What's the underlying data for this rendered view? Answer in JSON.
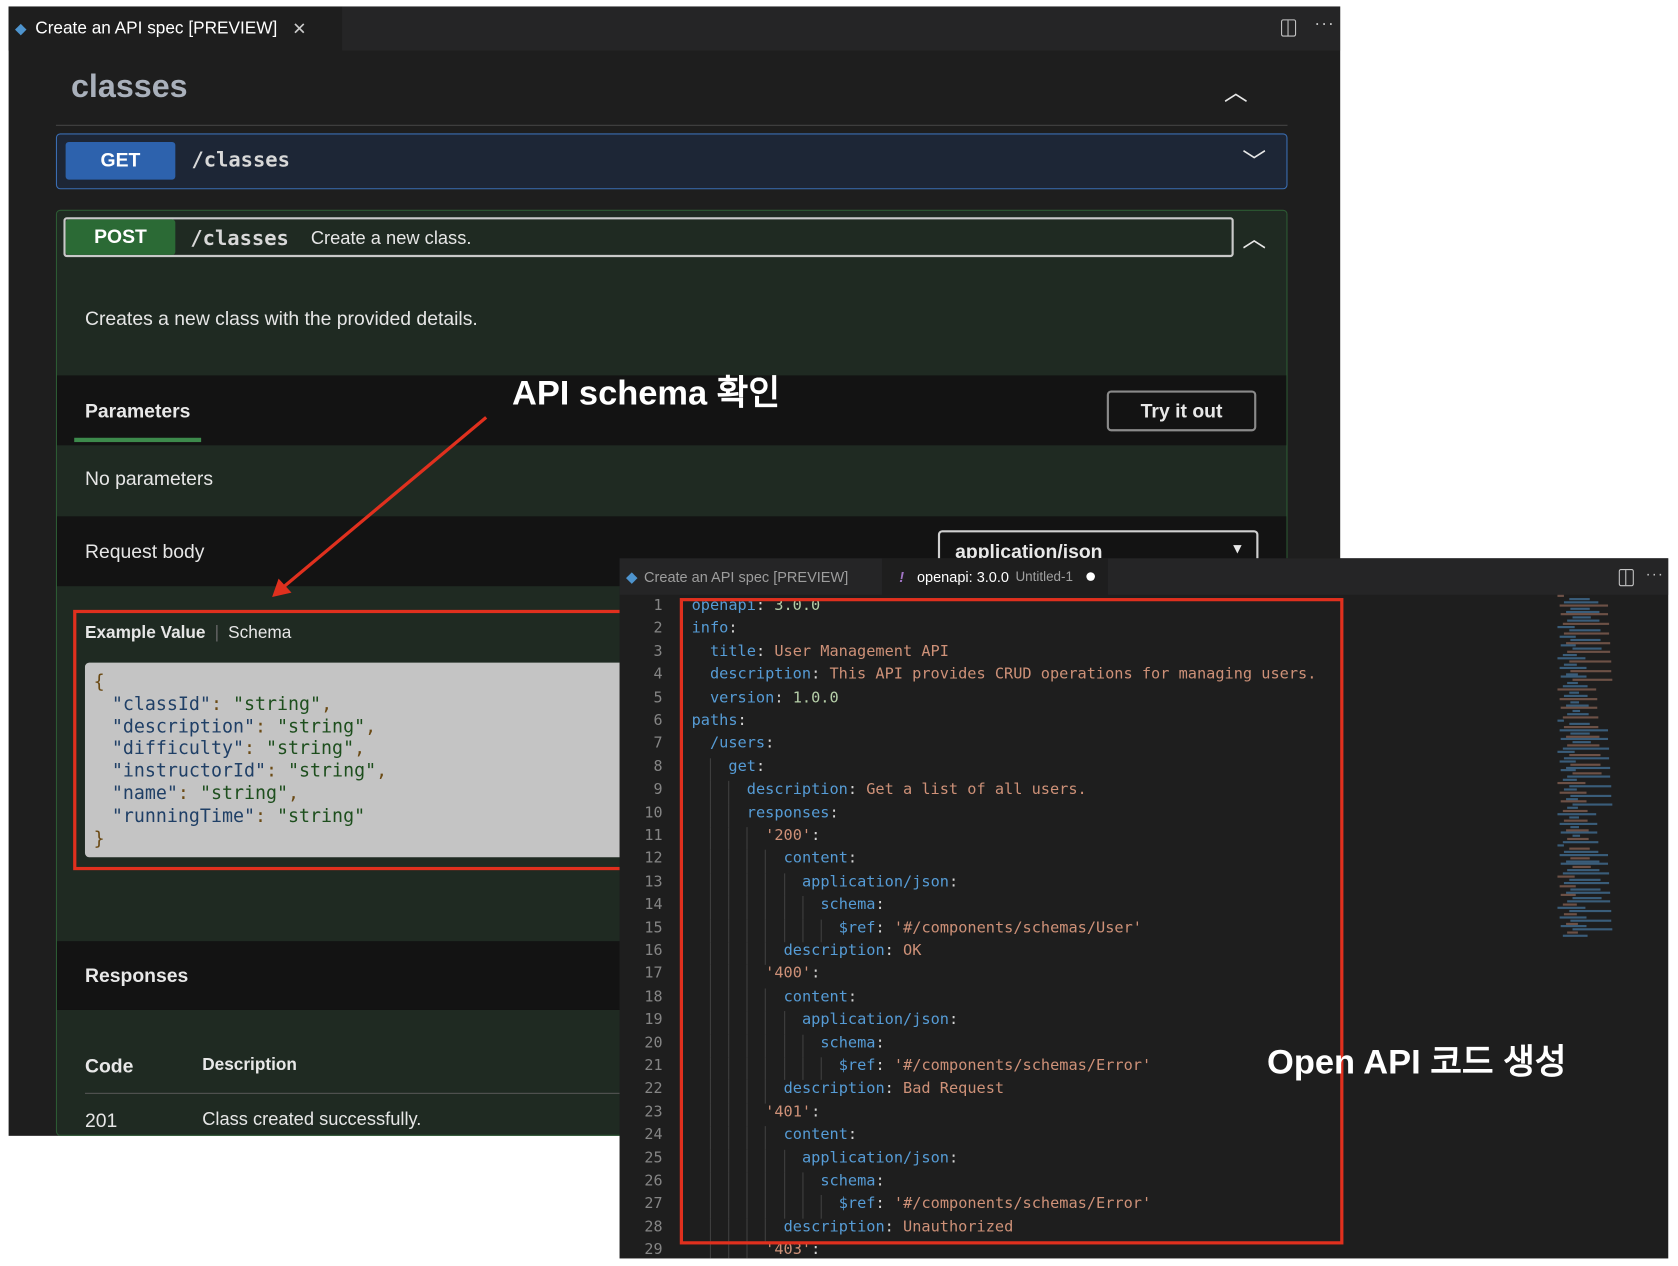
{
  "preview_window": {
    "tab_title": "Create an API spec [PREVIEW]",
    "section_title": "classes",
    "get_op": {
      "method": "GET",
      "path": "/classes"
    },
    "post_op": {
      "method": "POST",
      "path": "/classes",
      "summary": "Create a new class.",
      "description": "Creates a new class with the provided details.",
      "parameters_tab": "Parameters",
      "try_it_out": "Try it out",
      "no_parameters": "No parameters",
      "request_body_label": "Request body",
      "content_type": "application/json",
      "example_tab": "Example Value",
      "schema_tab": "Schema",
      "example_fields": [
        {
          "key": "classId",
          "value": "string"
        },
        {
          "key": "description",
          "value": "string"
        },
        {
          "key": "difficulty",
          "value": "string"
        },
        {
          "key": "instructorId",
          "value": "string"
        },
        {
          "key": "name",
          "value": "string"
        },
        {
          "key": "runningTime",
          "value": "string"
        }
      ],
      "responses_title": "Responses",
      "responses_headers": {
        "code": "Code",
        "description": "Description"
      },
      "responses": [
        {
          "code": "201",
          "description": "Class created successfully."
        }
      ]
    }
  },
  "editor_window": {
    "tabs": [
      {
        "label": "Create an API spec [PREVIEW]",
        "active": false
      },
      {
        "label": "openapi: 3.0.0",
        "sublabel": "Untitled-1",
        "active": true,
        "dirty": true
      }
    ],
    "lines": [
      {
        "indent": 0,
        "key": "openapi",
        "value": "3.0.0",
        "kind": "number"
      },
      {
        "indent": 0,
        "key": "info",
        "value": "",
        "kind": ""
      },
      {
        "indent": 1,
        "key": "title",
        "value": "User Management API",
        "kind": "string"
      },
      {
        "indent": 1,
        "key": "description",
        "value": "This API provides CRUD operations for managing users.",
        "kind": "string"
      },
      {
        "indent": 1,
        "key": "version",
        "value": "1.0.0",
        "kind": "number"
      },
      {
        "indent": 0,
        "key": "paths",
        "value": "",
        "kind": ""
      },
      {
        "indent": 1,
        "key": "/users",
        "value": "",
        "kind": ""
      },
      {
        "indent": 2,
        "key": "get",
        "value": "",
        "kind": ""
      },
      {
        "indent": 3,
        "key": "description",
        "value": "Get a list of all users.",
        "kind": "string"
      },
      {
        "indent": 3,
        "key": "responses",
        "value": "",
        "kind": ""
      },
      {
        "indent": 4,
        "key": "'200'",
        "value": "",
        "kind": "strkey"
      },
      {
        "indent": 5,
        "key": "content",
        "value": "",
        "kind": ""
      },
      {
        "indent": 6,
        "key": "application/json",
        "value": "",
        "kind": ""
      },
      {
        "indent": 7,
        "key": "schema",
        "value": "",
        "kind": ""
      },
      {
        "indent": 8,
        "key": "$ref",
        "value": "'#/components/schemas/User'",
        "kind": "string"
      },
      {
        "indent": 5,
        "key": "description",
        "value": "OK",
        "kind": "string"
      },
      {
        "indent": 4,
        "key": "'400'",
        "value": "",
        "kind": "strkey"
      },
      {
        "indent": 5,
        "key": "content",
        "value": "",
        "kind": ""
      },
      {
        "indent": 6,
        "key": "application/json",
        "value": "",
        "kind": ""
      },
      {
        "indent": 7,
        "key": "schema",
        "value": "",
        "kind": ""
      },
      {
        "indent": 8,
        "key": "$ref",
        "value": "'#/components/schemas/Error'",
        "kind": "string"
      },
      {
        "indent": 5,
        "key": "description",
        "value": "Bad Request",
        "kind": "string"
      },
      {
        "indent": 4,
        "key": "'401'",
        "value": "",
        "kind": "strkey"
      },
      {
        "indent": 5,
        "key": "content",
        "value": "",
        "kind": ""
      },
      {
        "indent": 6,
        "key": "application/json",
        "value": "",
        "kind": ""
      },
      {
        "indent": 7,
        "key": "schema",
        "value": "",
        "kind": ""
      },
      {
        "indent": 8,
        "key": "$ref",
        "value": "'#/components/schemas/Error'",
        "kind": "string"
      },
      {
        "indent": 5,
        "key": "description",
        "value": "Unauthorized",
        "kind": "string"
      },
      {
        "indent": 4,
        "key": "'403'",
        "value": "",
        "kind": "strkey"
      }
    ]
  },
  "annotations": {
    "schema_callout": "API schema 확인",
    "code_callout": "Open API 코드 생성",
    "highlight_color": "#e0301e"
  },
  "colors": {
    "get": "#2d62ad",
    "post": "#2b6a35",
    "yaml_key": "#569cd6",
    "yaml_string": "#ce9178",
    "yaml_number": "#b5cea8"
  }
}
